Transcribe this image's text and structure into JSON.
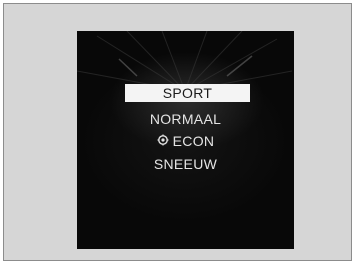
{
  "drive_mode_menu": {
    "items": [
      {
        "label": "SPORT",
        "selected": true
      },
      {
        "label": "NORMAAL",
        "selected": false
      },
      {
        "label": "ECON",
        "selected": false,
        "icon": "econ-leaf-icon"
      },
      {
        "label": "SNEEUW",
        "selected": false
      }
    ]
  },
  "colors": {
    "screen_background": "#080808",
    "frame_background": "#d6d6d6",
    "highlight": "#f4f4f4",
    "text": "#e4e4e4"
  }
}
